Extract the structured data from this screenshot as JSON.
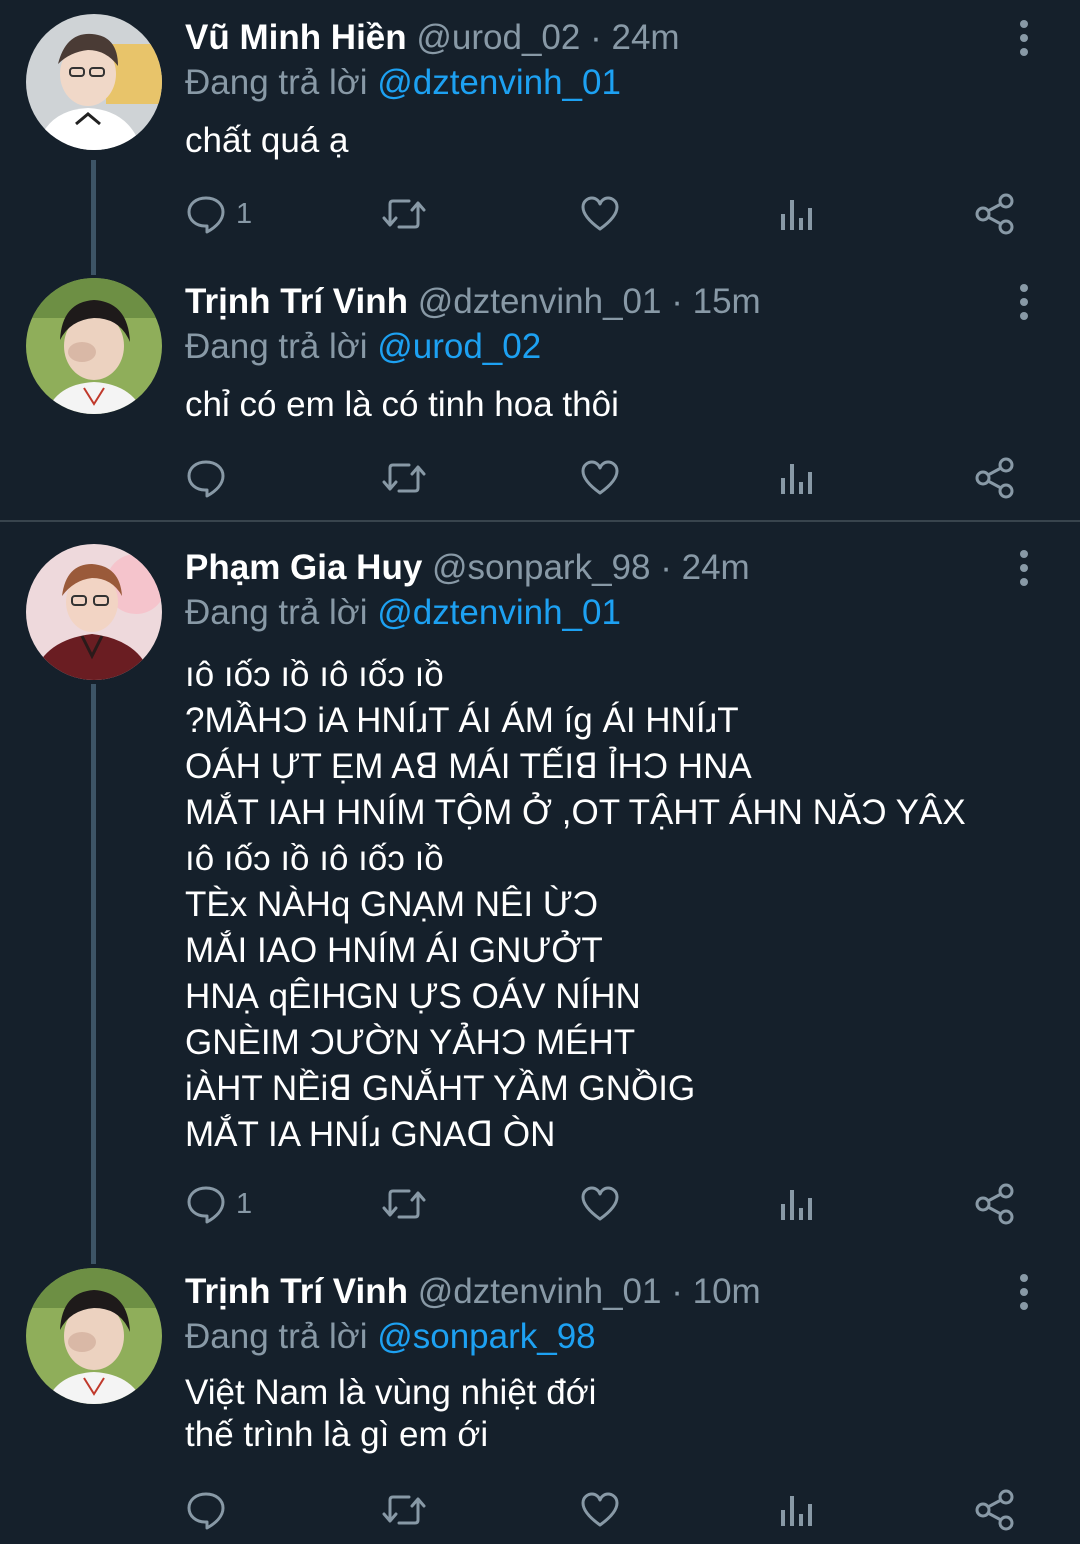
{
  "tweets": [
    {
      "name": "Vũ Minh Hiền",
      "handle": "@urod_02",
      "sep": "·",
      "time": "24m",
      "reply_prefix": "Đang trả lời",
      "reply_to": "@dztenvinh_01",
      "text": "chất quá ạ",
      "reply_count": "1",
      "avatar_desc": "avatar-vu-minh-hien"
    },
    {
      "name": "Trịnh Trí Vinh",
      "handle": "@dztenvinh_01",
      "sep": "·",
      "time": "15m",
      "reply_prefix": "Đang trả lời",
      "reply_to": "@urod_02",
      "text": "chỉ có em là có tinh hoa thôi",
      "reply_count": "",
      "avatar_desc": "avatar-trinh-tri-vinh"
    },
    {
      "name": "Phạm Gia Huy",
      "handle": "@sonpark_98",
      "sep": "·",
      "time": "24m",
      "reply_prefix": "Đang trả lời",
      "reply_to": "@dztenvinh_01",
      "text": "ıô ıốɔ ıồ ıô ıốɔ ıồ\n?MẦHƆ iA HNÍɹT ÁI ÁM íg ÁI HNÍɹT\nOÁH ỰT ẸM Aꓭ MÁI TẾIꓭ ỈHƆ HNA\nMẮT IAH HNÍM TỘM Ở ,OT TẬHT ÁHN NĂƆ YÂX\nıô ıốɔ ıồ ıô ıốɔ ıồ\nTÈx NÀHq GNẠM NÊI ỪƆ\nMẮI IAO HNÍM ÁI GNƯỞT\nHNẠ qÊIHGN ỰS OÁV NÍHN\nGNÈIM ƆƯỜN YẢHƆ MÉHT\niÀHT NỀiꓭ GNẮHT YẦM GNỒIG\nMẮT IA HNÍɹ GNAꓷ ÒN",
      "reply_count": "1",
      "avatar_desc": "avatar-pham-gia-huy"
    },
    {
      "name": "Trịnh Trí Vinh",
      "handle": "@dztenvinh_01",
      "sep": "·",
      "time": "10m",
      "reply_prefix": "Đang trả lời",
      "reply_to": "@sonpark_98",
      "text": "Việt Nam là vùng nhiệt đới\nthế trình là gì em ới",
      "reply_count": "",
      "avatar_desc": "avatar-trinh-tri-vinh"
    }
  ],
  "colors": {
    "background": "#15202b",
    "muted": "#8899a6",
    "accent": "#1da1f2",
    "thread_line": "#3d5466",
    "divider": "#38444d"
  },
  "icons": [
    "reply-icon",
    "retweet-icon",
    "like-icon",
    "analytics-icon",
    "share-icon",
    "more-icon"
  ]
}
